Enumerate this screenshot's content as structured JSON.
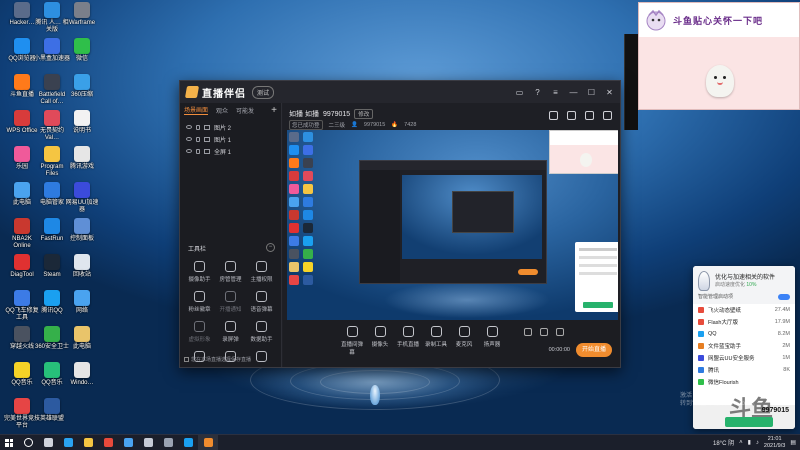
{
  "colors": {
    "accent": "#f08c2e",
    "panel_green": "#27b26c",
    "cam_bg": "#fbe4e4"
  },
  "desktop_icons": [
    {
      "label": "Hacker…",
      "icon": "app-icon",
      "color": "#5a6b8a"
    },
    {
      "label": "腾讯 人… 相关版",
      "icon": "app-icon",
      "color": "#2d8fe0"
    },
    {
      "label": "Warframe",
      "icon": "game-icon",
      "color": "#7a7f8a"
    },
    {
      "label": "QQ浏览器",
      "icon": "browser-icon",
      "color": "#1f8ff0"
    },
    {
      "label": "小黑盒加速器",
      "icon": "app-icon",
      "color": "#3d6fe5"
    },
    {
      "label": "微信",
      "icon": "wechat-icon",
      "color": "#2fbf4a"
    },
    {
      "label": "斗鱼直播",
      "icon": "app-icon",
      "color": "#ff7a1a"
    },
    {
      "label": "Battlefield Call of…",
      "icon": "game-icon",
      "color": "#3a4150"
    },
    {
      "label": "360压缩",
      "icon": "app-icon",
      "color": "#3aa0e8"
    },
    {
      "label": "WPS Office",
      "icon": "office-icon",
      "color": "#d83b3b"
    },
    {
      "label": "无畏契约 Val…",
      "icon": "game-icon",
      "color": "#e04a5a"
    },
    {
      "label": "说明书",
      "icon": "doc-icon",
      "color": "#f2f2f2"
    },
    {
      "label": "乐园",
      "icon": "app-icon",
      "color": "#f05a9a"
    },
    {
      "label": "Program Files",
      "icon": "folder-icon",
      "color": "#f5c542"
    },
    {
      "label": "腾讯游戏",
      "icon": "app-icon",
      "color": "#e6e6e6"
    },
    {
      "label": "此电脑",
      "icon": "computer-icon",
      "color": "#4aa3ef"
    },
    {
      "label": "电脑管家",
      "icon": "app-icon",
      "color": "#2e7be0"
    },
    {
      "label": "网易UU加速器",
      "icon": "app-icon",
      "color": "#3b4bdb"
    },
    {
      "label": "NBA2K Online",
      "icon": "game-icon",
      "color": "#c9382f"
    },
    {
      "label": "FastRun",
      "icon": "app-icon",
      "color": "#1e88e5"
    },
    {
      "label": "控制面板",
      "icon": "settings-icon",
      "color": "#5f8fd6"
    },
    {
      "label": "DiagTool",
      "icon": "app-icon",
      "color": "#e03131"
    },
    {
      "label": "Steam",
      "icon": "steam-icon",
      "color": "#1b2838"
    },
    {
      "label": "回收站",
      "icon": "trash-icon",
      "color": "#dfe6ee"
    },
    {
      "label": "QQ飞车修复工具",
      "icon": "app-icon",
      "color": "#3c7be6"
    },
    {
      "label": "腾讯QQ",
      "icon": "qq-icon",
      "color": "#1aa0f0"
    },
    {
      "label": "网络",
      "icon": "network-icon",
      "color": "#4aa3ef"
    },
    {
      "label": "穿越火线",
      "icon": "game-icon",
      "color": "#4a5260"
    },
    {
      "label": "360安全卫士",
      "icon": "app-icon",
      "color": "#35b04a"
    },
    {
      "label": "此电脑",
      "icon": "computer-icon",
      "color": "#e9c46a"
    },
    {
      "label": "QQ音乐",
      "icon": "music-icon",
      "color": "#f5d327"
    },
    {
      "label": "QQ音乐",
      "icon": "music-icon",
      "color": "#27c07a"
    },
    {
      "label": "Windo…",
      "icon": "app-icon",
      "color": "#e6e6e6"
    },
    {
      "label": "完美世界竞技平台",
      "icon": "app-icon",
      "color": "#e64545"
    },
    {
      "label": "英雄联盟",
      "icon": "game-icon",
      "color": "#2c5aa0"
    }
  ],
  "app": {
    "name": "直播伴侣",
    "version": "测试",
    "left_tabs": [
      "场景画面",
      "观众",
      "可能发"
    ],
    "scenes": [
      "图片 2",
      "图片 1",
      "全屏 1"
    ],
    "tools_title": "工具栏",
    "tools": [
      {
        "label": "摄像助手",
        "dim": false
      },
      {
        "label": "房管管理",
        "dim": false
      },
      {
        "label": "主播权限",
        "dim": false
      },
      {
        "label": "粉丝徽章",
        "dim": false
      },
      {
        "label": "开播通知",
        "dim": true
      },
      {
        "label": "语音弹幕",
        "dim": false
      },
      {
        "label": "虚拟形象",
        "dim": true
      },
      {
        "label": "录屏弹",
        "dim": false
      },
      {
        "label": "数据助手",
        "dim": false
      },
      {
        "label": "",
        "dim": false
      },
      {
        "label": "",
        "dim": false
      },
      {
        "label": "",
        "dim": false
      }
    ],
    "notice": "您在本场直播选择保存直播",
    "room_name": "如播  如播",
    "room_id": "9979015",
    "room_edit": "修改",
    "room_tag": "您已成功登",
    "room_category": "二三级",
    "viewers_icon_value": "9979015",
    "viewer_count": "7428",
    "bottom_controls": [
      "直播间弹幕",
      "摄像头",
      "手机直播",
      "录制工具",
      "麦克风",
      "扬声器"
    ],
    "timer": "00:00:00",
    "start_label": "开始直播"
  },
  "cam_overlay": {
    "title": "斗鱼贴心关怀一下吧"
  },
  "startup_panel": {
    "title": "优化与加速相关的软件",
    "subtitle_prefix": "启动速度优化",
    "subtitle_value": "10%",
    "toggle_label": "智能管理启动项",
    "items": [
      {
        "name": "飞火动态壁纸",
        "value": "27.4M",
        "color": "#e74c3c"
      },
      {
        "name": "Flash大厅版",
        "value": "17.9M",
        "color": "#e74c3c"
      },
      {
        "name": "QQ",
        "value": "8.2M",
        "color": "#1aa0f0"
      },
      {
        "name": "文件蓝宝助手",
        "value": "2M",
        "color": "#e67e22"
      },
      {
        "name": "网盟云UU安全服务",
        "value": "1M",
        "color": "#3b4bdb"
      },
      {
        "name": "腾讯",
        "value": "8K",
        "color": "#2e7be0"
      },
      {
        "name": "微信Flourish",
        "value": "",
        "color": "#2fbf4a"
      }
    ],
    "brand": "斗鱼",
    "room": "9979015"
  },
  "watermark": [
    "激活 Windows",
    "转到\"设置\"以激活 Windows。"
  ],
  "taskbar": {
    "items": [
      {
        "icon": "search-icon",
        "color": "#ffffff",
        "active": false
      },
      {
        "icon": "task-view-icon",
        "color": "#cfd3dc",
        "active": false
      },
      {
        "icon": "edge-icon",
        "color": "#2aa3f0",
        "active": false
      },
      {
        "icon": "folder-icon",
        "color": "#f5c542",
        "active": false
      },
      {
        "icon": "chrome-icon",
        "color": "#e84a3b",
        "active": false
      },
      {
        "icon": "store-icon",
        "color": "#4aa3ef",
        "active": false
      },
      {
        "icon": "app-icon",
        "color": "#c6cbd6",
        "active": false
      },
      {
        "icon": "settings-icon",
        "color": "#9aa3b2",
        "active": false
      },
      {
        "icon": "qq-icon",
        "color": "#1aa0f0",
        "active": false
      },
      {
        "icon": "douyu-icon",
        "color": "#f08c2e",
        "active": true
      }
    ],
    "weather": "18°C 阴",
    "time": "21:01",
    "date": "2021/9/3"
  }
}
